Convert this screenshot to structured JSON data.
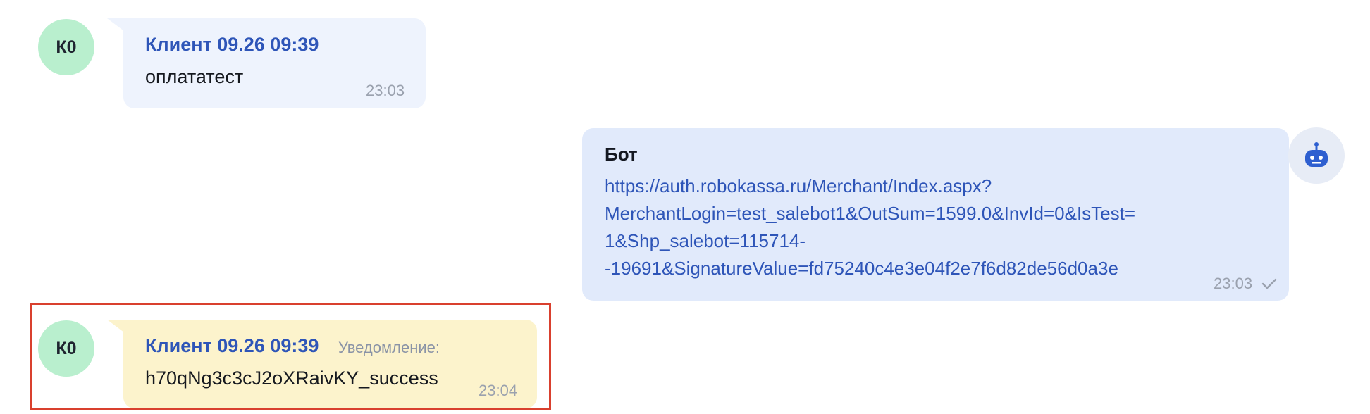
{
  "messages": [
    {
      "avatar_initials": "К0",
      "sender": "Клиент 09.26 09:39",
      "text": "оплататест",
      "time": "23:03"
    },
    {
      "sender": "Бот",
      "link_lines": [
        "https://auth.robokassa.ru/Merchant/Index.aspx?",
        "MerchantLogin=test_salebot1&OutSum=1599.0&InvId=0&IsTest=",
        "1&Shp_salebot=115714-",
        "-19691&SignatureValue=fd75240c4e3e04f2e7f6d82de56d0a3e"
      ],
      "time": "23:03",
      "status_icon": "check-icon"
    },
    {
      "avatar_initials": "К0",
      "sender": "Клиент 09.26 09:39",
      "label": "Уведомление:",
      "text": "h70qNg3c3cJ2oXRaivKY_success",
      "time": "23:04"
    }
  ],
  "colors": {
    "client_bubble": "#eef3fd",
    "bot_bubble": "#e1eafb",
    "notification_bubble": "#fcf3cc",
    "client_avatar": "#b9efce",
    "sender_name": "#2e55b8",
    "highlight_border": "#d9402e"
  }
}
